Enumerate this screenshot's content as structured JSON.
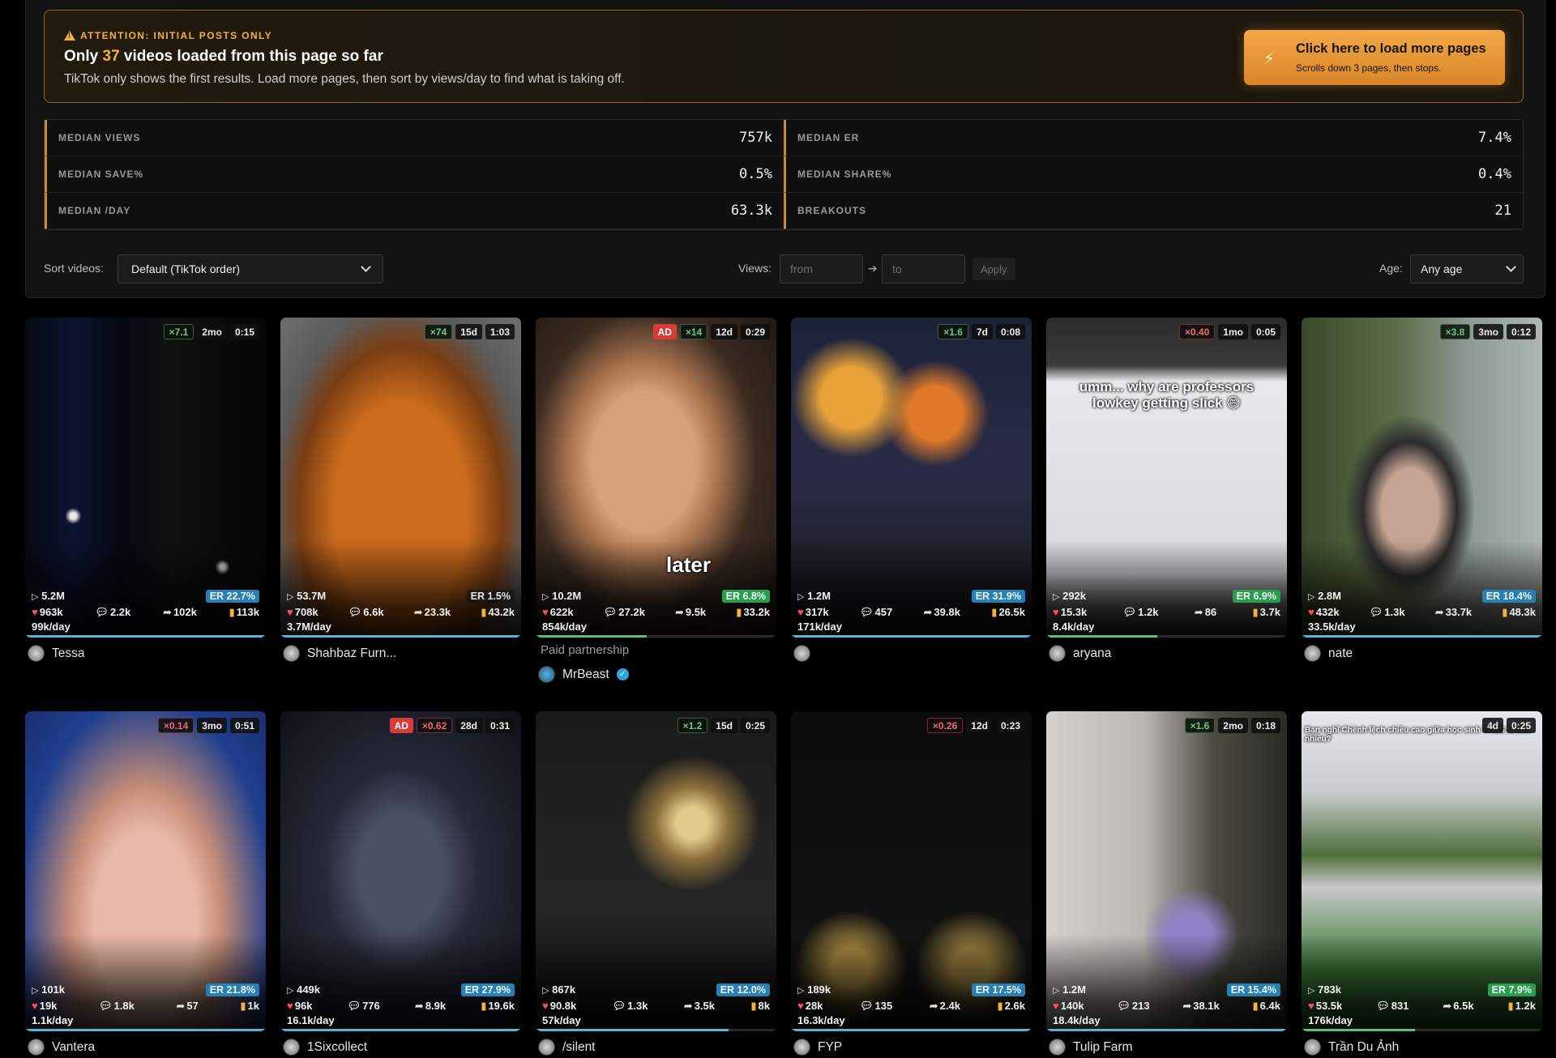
{
  "banner": {
    "attention": "ATTENTION: INITIAL POSTS ONLY",
    "headline_prefix": "Only ",
    "headline_count": "37",
    "headline_suffix": " videos loaded from this page so far",
    "sub": "TikTok only shows the first results. Load more pages, then sort by views/day to find what is taking off.",
    "load_button_title": "Click here to load more pages",
    "load_button_sub": "Scrolls down 3 pages, then stops.",
    "load_button_icon": "bolt-icon"
  },
  "stats": [
    {
      "label": "MEDIAN VIEWS",
      "value": "757k"
    },
    {
      "label": "MEDIAN ER",
      "value": "7.4%"
    },
    {
      "label": "MEDIAN SAVE%",
      "value": "0.5%"
    },
    {
      "label": "MEDIAN SHARE%",
      "value": "0.4%"
    },
    {
      "label": "MEDIAN /DAY",
      "value": "63.3k"
    },
    {
      "label": "BREAKOUTS",
      "value": "21"
    }
  ],
  "controls": {
    "sort_label": "Sort videos:",
    "sort_value": "Default (TikTok order)",
    "views_label": "Views:",
    "views_from_placeholder": "from",
    "views_to_placeholder": "to",
    "views_arrow": "➔",
    "apply_label": "Apply",
    "age_label": "Age:",
    "age_value": "Any age"
  },
  "colors": {
    "accent": "#f2b23e",
    "er_blue": "#2a7fb1",
    "er_green": "#2e9b52",
    "ad_red": "#d93b3b"
  },
  "videos": [
    {
      "multiplier": "×7.1",
      "mult_dir": "up",
      "age": "2mo",
      "duration": "0:15",
      "ad": false,
      "views": "5.2M",
      "er": "ER 22.7%",
      "er_color": "blue",
      "likes": "963k",
      "comments": "2.2k",
      "shares": "102k",
      "saves": "113k",
      "per_day": "99k/day",
      "progress": 1.0,
      "author": "Tessa",
      "paid": ""
    },
    {
      "multiplier": "×74",
      "mult_dir": "up",
      "age": "15d",
      "duration": "1:03",
      "ad": false,
      "views": "53.7M",
      "er": "ER 1.5%",
      "er_color": "gray",
      "likes": "708k",
      "comments": "6.6k",
      "shares": "23.3k",
      "saves": "43.2k",
      "per_day": "3.7M/day",
      "progress": 1.0,
      "author": "Shahbaz Furn...",
      "paid": ""
    },
    {
      "multiplier": "×14",
      "mult_dir": "up",
      "age": "12d",
      "duration": "0:29",
      "ad": true,
      "ad_label": "AD",
      "views": "10.2M",
      "er": "ER 6.8%",
      "er_color": "green",
      "likes": "622k",
      "comments": "27.2k",
      "shares": "9.5k",
      "saves": "33.2k",
      "per_day": "854k/day",
      "progress": 0.46,
      "progress_color": "green",
      "author": "MrBeast",
      "paid": "Paid partnership",
      "verified": true,
      "overlay": "later"
    },
    {
      "multiplier": "×1.6",
      "mult_dir": "up",
      "age": "7d",
      "duration": "0:08",
      "ad": false,
      "views": "1.2M",
      "er": "ER 31.9%",
      "er_color": "blue",
      "likes": "317k",
      "comments": "457",
      "shares": "39.8k",
      "saves": "26.5k",
      "per_day": "171k/day",
      "progress": 1.0,
      "author": "",
      "paid": ""
    },
    {
      "multiplier": "×0.40",
      "mult_dir": "down",
      "age": "1mo",
      "duration": "0:05",
      "ad": false,
      "views": "292k",
      "er": "ER 6.9%",
      "er_color": "green",
      "likes": "15.3k",
      "comments": "1.2k",
      "shares": "86",
      "saves": "3.7k",
      "per_day": "8.4k/day",
      "progress": 0.46,
      "progress_color": "green",
      "author": "aryana",
      "paid": "",
      "overlay": "umm... why are professors lowkey getting slick 😅"
    },
    {
      "multiplier": "×3.8",
      "mult_dir": "up",
      "age": "3mo",
      "duration": "0:12",
      "ad": false,
      "views": "2.8M",
      "er": "ER 18.4%",
      "er_color": "blue",
      "likes": "432k",
      "comments": "1.3k",
      "shares": "33.7k",
      "saves": "48.3k",
      "per_day": "33.5k/day",
      "progress": 1.0,
      "author": "nate",
      "paid": ""
    },
    {
      "multiplier": "×0.14",
      "mult_dir": "down",
      "age": "3mo",
      "duration": "0:51",
      "ad": false,
      "views": "101k",
      "er": "ER 21.8%",
      "er_color": "blue",
      "likes": "19k",
      "comments": "1.8k",
      "shares": "57",
      "saves": "1k",
      "per_day": "1.1k/day",
      "progress": 1.0,
      "author": "Vantera",
      "paid": ""
    },
    {
      "multiplier": "×0.62",
      "mult_dir": "down",
      "age": "28d",
      "duration": "0:31",
      "ad": true,
      "ad_label": "AD",
      "views": "449k",
      "er": "ER 27.9%",
      "er_color": "blue",
      "likes": "96k",
      "comments": "776",
      "shares": "8.9k",
      "saves": "19.6k",
      "per_day": "16.1k/day",
      "progress": 1.0,
      "author": "1Sixcollect",
      "paid": ""
    },
    {
      "multiplier": "×1.2",
      "mult_dir": "up",
      "age": "15d",
      "duration": "0:25",
      "ad": false,
      "views": "867k",
      "er": "ER 12.0%",
      "er_color": "blue",
      "likes": "90.8k",
      "comments": "1.3k",
      "shares": "3.5k",
      "saves": "8k",
      "per_day": "57k/day",
      "progress": 0.8,
      "author": "/silent",
      "paid": ""
    },
    {
      "multiplier": "×0.26",
      "mult_dir": "down",
      "age": "12d",
      "duration": "0:23",
      "ad": false,
      "views": "189k",
      "er": "ER 17.5%",
      "er_color": "blue",
      "likes": "28k",
      "comments": "135",
      "shares": "2.4k",
      "saves": "2.6k",
      "per_day": "16.3k/day",
      "progress": 1.0,
      "author": "FYP",
      "paid": ""
    },
    {
      "multiplier": "×1.6",
      "mult_dir": "up",
      "age": "2mo",
      "duration": "0:18",
      "ad": false,
      "views": "1.2M",
      "er": "ER 15.4%",
      "er_color": "blue",
      "likes": "140k",
      "comments": "213",
      "shares": "38.1k",
      "saves": "6.4k",
      "per_day": "18.4k/day",
      "progress": 1.0,
      "author": "Tulip Farm",
      "paid": ""
    },
    {
      "multiplier": "",
      "mult_dir": "up",
      "age": "4d",
      "duration": "0:25",
      "ad": false,
      "views": "783k",
      "er": "ER 7.9%",
      "er_color": "green",
      "likes": "53.5k",
      "comments": "831",
      "shares": "6.5k",
      "saves": "1.2k",
      "per_day": "176k/day",
      "progress": 0.47,
      "progress_color": "green",
      "author": "Trần Du Ảnh",
      "paid": "",
      "overlay": "Bạn nghĩ Chênh lệch chiều cao giữa học sinh THCS là bao nhiêu?"
    }
  ]
}
